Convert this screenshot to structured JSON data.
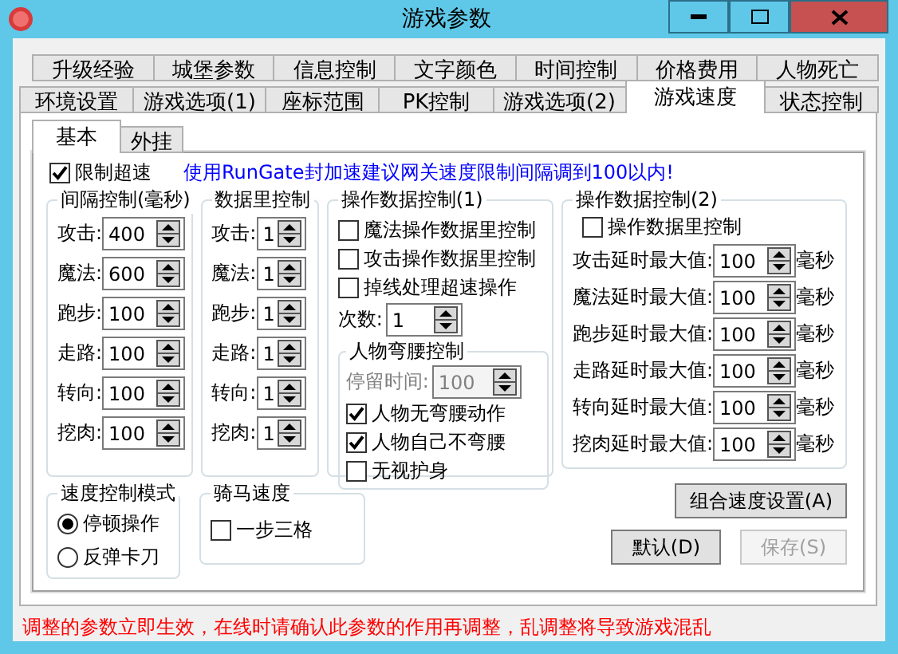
{
  "window": {
    "title": "游戏参数"
  },
  "tab_rows": [
    [
      {
        "label": "升级经验",
        "selected": false
      },
      {
        "label": "城堡参数",
        "selected": false
      },
      {
        "label": "信息控制",
        "selected": false
      },
      {
        "label": "文字颜色",
        "selected": false
      },
      {
        "label": "时间控制",
        "selected": false
      },
      {
        "label": "价格费用",
        "selected": false
      },
      {
        "label": "人物死亡",
        "selected": false
      }
    ],
    [
      {
        "label": "环境设置",
        "selected": false
      },
      {
        "label": "游戏选项(1)",
        "selected": false
      },
      {
        "label": "座标范围",
        "selected": false
      },
      {
        "label": "PK控制",
        "selected": false
      },
      {
        "label": "游戏选项(2)",
        "selected": false
      },
      {
        "label": "游戏速度",
        "selected": true
      },
      {
        "label": "状态控制",
        "selected": false
      }
    ]
  ],
  "sub_tabs": [
    {
      "label": "基本",
      "selected": true
    },
    {
      "label": "外挂",
      "selected": false
    }
  ],
  "limit_speed": {
    "label": "限制超速",
    "checked": true
  },
  "notice": "使用RunGate封加速建议网关速度限制间隔调到100以内!",
  "interval_group": {
    "title": "间隔控制(毫秒)",
    "rows": [
      {
        "label": "攻击:",
        "value": "400"
      },
      {
        "label": "魔法:",
        "value": "600"
      },
      {
        "label": "跑步:",
        "value": "100"
      },
      {
        "label": "走路:",
        "value": "100"
      },
      {
        "label": "转向:",
        "value": "100"
      },
      {
        "label": "挖肉:",
        "value": "100"
      }
    ]
  },
  "count_group": {
    "title": "数据里控制",
    "rows": [
      {
        "label": "攻击:",
        "value": "1"
      },
      {
        "label": "魔法:",
        "value": "1"
      },
      {
        "label": "跑步:",
        "value": "1"
      },
      {
        "label": "走路:",
        "value": "1"
      },
      {
        "label": "转向:",
        "value": "1"
      },
      {
        "label": "挖肉:",
        "value": "1"
      }
    ]
  },
  "op_group_1": {
    "title": "操作数据控制(1)",
    "checks": [
      {
        "label": "魔法操作数据里控制",
        "checked": false
      },
      {
        "label": "攻击操作数据里控制",
        "checked": false
      },
      {
        "label": "掉线处理超速操作",
        "checked": false
      }
    ],
    "count": {
      "label": "次数:",
      "value": "1"
    },
    "bend": {
      "title": "人物弯腰控制",
      "stay": {
        "label": "停留时间:",
        "value": "100",
        "disabled": true
      },
      "checks": [
        {
          "label": "人物无弯腰动作",
          "checked": true
        },
        {
          "label": "人物自己不弯腰",
          "checked": true
        },
        {
          "label": "无视护身",
          "checked": false
        }
      ]
    }
  },
  "op_group_2": {
    "title": "操作数据控制(2)",
    "check": {
      "label": "操作数据里控制",
      "checked": false
    },
    "rows": [
      {
        "label": "攻击延时最大值:",
        "value": "100",
        "unit": "毫秒"
      },
      {
        "label": "魔法延时最大值:",
        "value": "100",
        "unit": "毫秒"
      },
      {
        "label": "跑步延时最大值:",
        "value": "100",
        "unit": "毫秒"
      },
      {
        "label": "走路延时最大值:",
        "value": "100",
        "unit": "毫秒"
      },
      {
        "label": "转向延时最大值:",
        "value": "100",
        "unit": "毫秒"
      },
      {
        "label": "挖肉延时最大值:",
        "value": "100",
        "unit": "毫秒"
      }
    ]
  },
  "mode_group": {
    "title": "速度控制模式",
    "options": [
      {
        "label": "停顿操作",
        "selected": true
      },
      {
        "label": "反弹卡刀",
        "selected": false
      }
    ]
  },
  "ride_group": {
    "title": "骑马速度",
    "check": {
      "label": "一步三格",
      "checked": false
    }
  },
  "buttons": [
    {
      "label": "组合速度设置(A)",
      "disabled": false
    },
    {
      "label": "默认(D)",
      "disabled": false
    },
    {
      "label": "保存(S)",
      "disabled": true
    }
  ],
  "warning": "调整的参数立即生效，在线时请确认此参数的作用再调整，乱调整将导致游戏混乱"
}
